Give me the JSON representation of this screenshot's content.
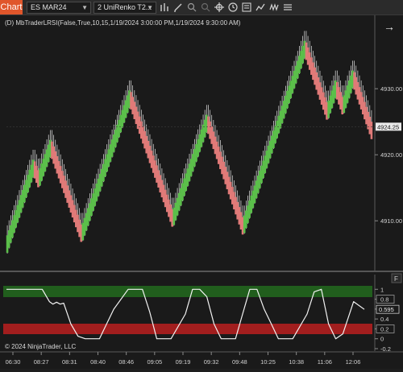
{
  "toolbar": {
    "chart_tab": "Chart",
    "instrument": "ES MAR24",
    "bar_type": "2 UniRenko T2...",
    "icons": [
      "bar-chart-icon",
      "draw-pencil-icon",
      "zoom-in-icon",
      "zoom-out-icon",
      "crosshair-icon",
      "clock-icon",
      "properties-icon",
      "chart-style-icon",
      "strategy-icon",
      "list-icon"
    ]
  },
  "chart": {
    "indicator_label": "(D) MbTraderLRSI(False,True,10,15,1/19/2024 3:00:00 PM,1/19/2024 9:30:00 AM)",
    "arrow_glyph": "→",
    "copyright": "© 2024 NinjaTrader, LLC",
    "panel_badge_top": "F",
    "panel_badge_bottom": "F",
    "price_ticks": [
      "4930.00",
      "4920.00",
      "4910.00"
    ],
    "last_price": "4924.25",
    "time_ticks": [
      "06:30",
      "08:27",
      "08:31",
      "08:40",
      "08:46",
      "09:05",
      "09:19",
      "09:32",
      "09:48",
      "10:25",
      "10:38",
      "11:06",
      "12:06"
    ],
    "colors": {
      "up": "#5bbf4a",
      "down": "#e07a78",
      "wick": "#e8e8e8",
      "upper_band": "#215e1d",
      "lower_band": "#a21e1e"
    }
  },
  "chart_data": [
    {
      "type": "candlestick",
      "ylim": [
        4903.2,
        4938.8
      ],
      "last_price": 4924.25,
      "y_ticks": [
        4930,
        4920,
        4910
      ],
      "x_tick_labels": [
        "06:30",
        "08:27",
        "08:31",
        "08:40",
        "08:46",
        "09:05",
        "09:19",
        "09:32",
        "09:48",
        "10:25",
        "10:38",
        "11:06",
        "12:06"
      ],
      "segments": [
        {
          "dir": "up",
          "from": 4906.8,
          "to": 4919.0
        },
        {
          "dir": "down",
          "from": 4919.0,
          "to": 4917.0
        },
        {
          "dir": "up",
          "from": 4917.0,
          "to": 4922.0
        },
        {
          "dir": "down",
          "from": 4922.0,
          "to": 4908.7
        },
        {
          "dir": "up",
          "from": 4908.7,
          "to": 4929.5
        },
        {
          "dir": "down",
          "from": 4929.5,
          "to": 4911.0
        },
        {
          "dir": "up",
          "from": 4911.0,
          "to": 4925.8
        },
        {
          "dir": "down",
          "from": 4925.8,
          "to": 4909.8
        },
        {
          "dir": "up",
          "from": 4909.8,
          "to": 4937.0
        },
        {
          "dir": "down",
          "from": 4937.0,
          "to": 4927.2
        },
        {
          "dir": "up",
          "from": 4927.2,
          "to": 4931.0
        },
        {
          "dir": "down",
          "from": 4931.0,
          "to": 4928.0
        },
        {
          "dir": "up",
          "from": 4928.0,
          "to": 4932.5
        },
        {
          "dir": "down",
          "from": 4932.5,
          "to": 4924.25
        }
      ]
    },
    {
      "type": "line",
      "name": "LRSI",
      "ylim": [
        -0.2,
        1.2
      ],
      "y_ticks": [
        1,
        0.8,
        0.6,
        0.4,
        0.2,
        0,
        -0.2
      ],
      "levels": [
        0.8,
        0.2
      ],
      "last_value": 0.595,
      "x": [
        0,
        0.1,
        0.12,
        0.13,
        0.14,
        0.15,
        0.16,
        0.18,
        0.2,
        0.22,
        0.24,
        0.26,
        0.3,
        0.34,
        0.38,
        0.4,
        0.42,
        0.46,
        0.5,
        0.52,
        0.54,
        0.56,
        0.58,
        0.6,
        0.64,
        0.66,
        0.68,
        0.7,
        0.72,
        0.74,
        0.76,
        0.8,
        0.84,
        0.86,
        0.88,
        0.9,
        0.92,
        0.94,
        0.97,
        1.0
      ],
      "values": [
        1,
        1,
        0.75,
        0.7,
        0.74,
        0.7,
        0.72,
        0.3,
        0.05,
        0,
        0,
        0,
        0.6,
        1,
        1,
        0.55,
        0,
        0,
        0.5,
        1,
        1,
        0.85,
        0.3,
        0,
        0,
        0.5,
        1,
        1,
        0.6,
        0.3,
        0,
        0,
        0.5,
        0.95,
        1,
        0.3,
        0,
        0.1,
        0.75,
        0.595
      ]
    }
  ]
}
